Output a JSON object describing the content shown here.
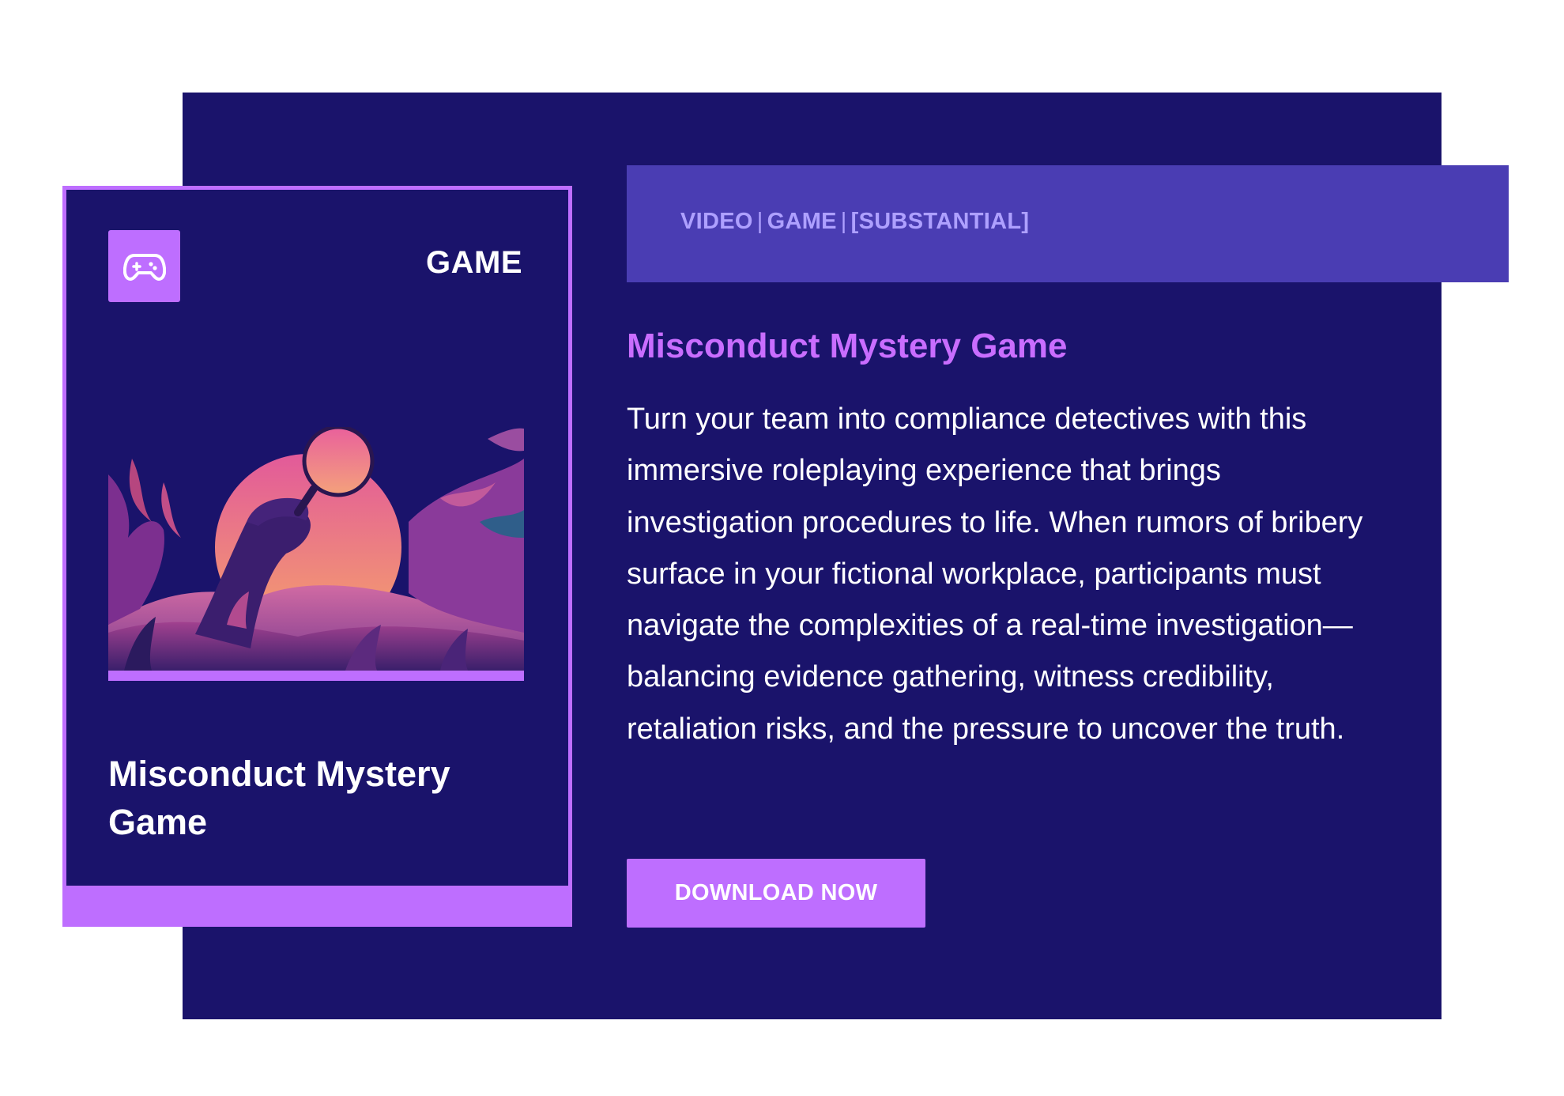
{
  "card": {
    "icon": "gamepad-icon",
    "type_label": "GAME",
    "title": "Misconduct Mystery Game",
    "illustration": "magnifying-glass-jungle-illustration"
  },
  "tags": {
    "items": [
      "VIDEO",
      "GAME",
      "[SUBSTANTIAL]"
    ],
    "separator": "|"
  },
  "content": {
    "title": "Misconduct Mystery Game",
    "description": "Turn your team into compliance detectives with this immersive roleplaying experience that brings investigation procedures to life. When rumors of bribery surface in your fictional workplace, participants must navigate the complexities of a real-time investigation—balancing evidence gathering, witness credibility, retaliation risks, and the pressure to uncover the truth."
  },
  "actions": {
    "download_label": "DOWNLOAD NOW"
  },
  "colors": {
    "panel_bg": "#1a136b",
    "accent": "#be6eff",
    "tag_banner": "#4a3db3",
    "tag_text": "#aea0ff",
    "title_text": "#c96dff"
  }
}
